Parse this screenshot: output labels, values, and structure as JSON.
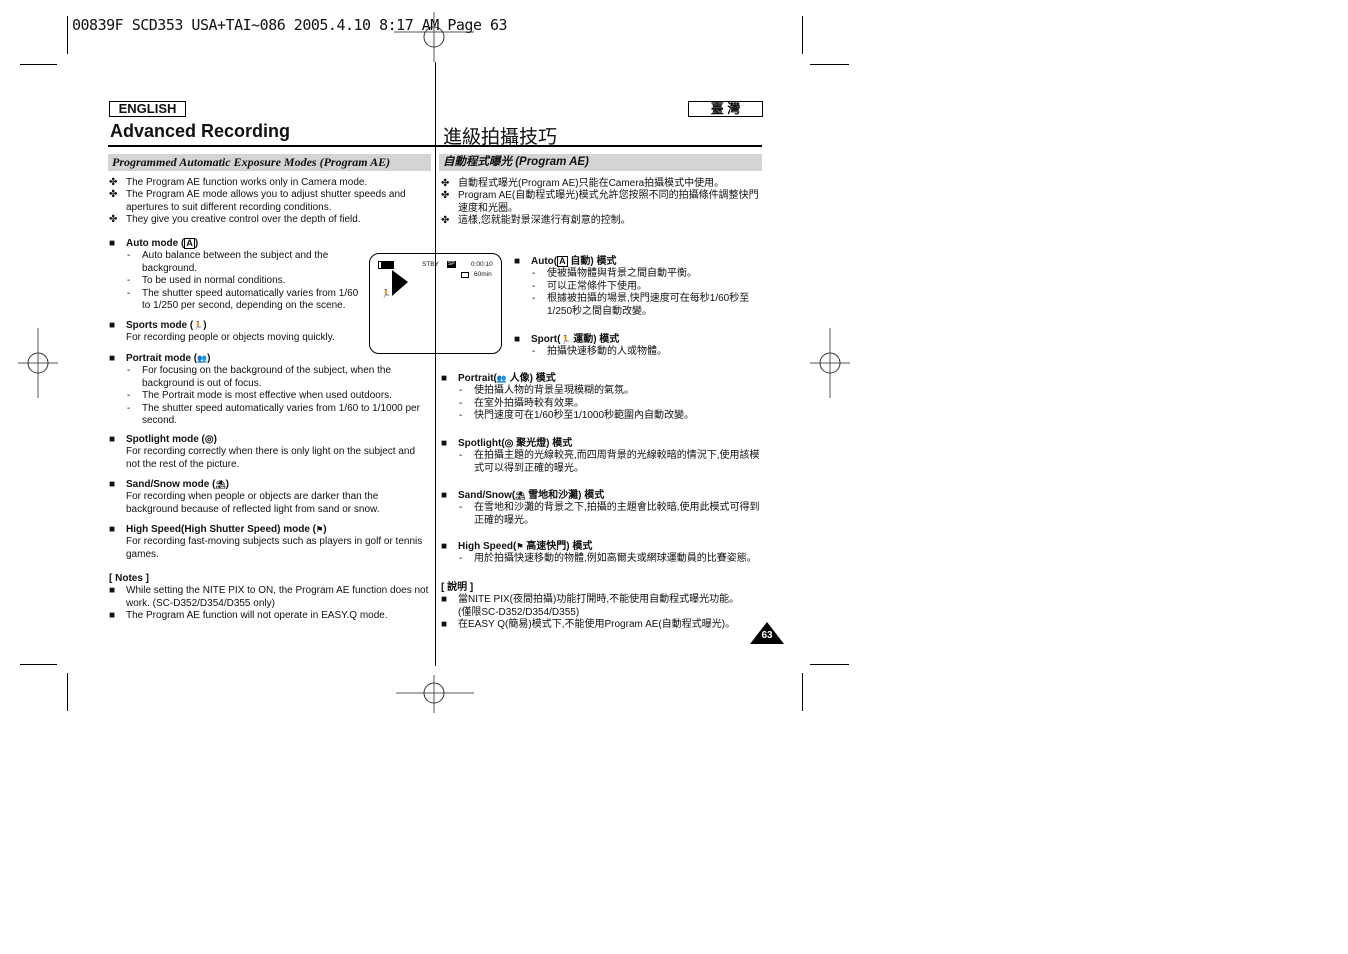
{
  "print_slug": "00839F SCD353 USA+TAI~086  2005.4.10  8:17 AM  Page 63",
  "english": {
    "lang_label": "ENGLISH",
    "title": "Advanced Recording",
    "section_title": "Programmed  Automatic Exposure Modes (Program AE)",
    "intro_bullets": [
      "The Program AE function works only in Camera mode.",
      "The Program AE mode allows you to adjust shutter speeds and apertures to suit different recording conditions.",
      "They give you creative control over the depth of field."
    ],
    "modes": [
      {
        "heading": "Auto mode (",
        "icon": "A",
        "heading_end": ")",
        "lines": [
          "Auto balance between the subject and the background.",
          "To be used in normal conditions.",
          "The shutter speed automatically varies from 1/60 to 1/250 per second, depending on the scene."
        ]
      },
      {
        "heading": "Sports mode (",
        "icon": "🏃",
        "heading_end": ")",
        "text": "For recording people or objects moving quickly."
      },
      {
        "heading": "Portrait mode (",
        "icon": "👥",
        "heading_end": ")",
        "lines": [
          "For focusing on the background of the subject, when the background is out of focus.",
          "The Portrait mode is most effective when used outdoors.",
          "The shutter speed automatically varies from 1/60 to 1/1000 per second."
        ]
      },
      {
        "heading": "Spotlight mode (",
        "icon": "◎",
        "heading_end": ")",
        "text": "For recording correctly when there is only light on the subject and not the rest of the picture."
      },
      {
        "heading": "Sand/Snow mode (",
        "icon": "⛱",
        "heading_end": ")",
        "text": "For recording when people or objects are darker than the background because of reflected light from sand or snow."
      },
      {
        "heading": "High Speed(High Shutter Speed) mode (",
        "icon": "⚑",
        "heading_end": ")",
        "text": "For recording fast-moving subjects such as players in golf or tennis games."
      }
    ],
    "notes_label": "[ Notes ]",
    "notes": [
      "While setting the NITE PIX to ON, the Program AE function does not work. (SC-D352/D354/D355 only)",
      "The Program AE function will not operate in EASY.Q mode."
    ]
  },
  "lcd": {
    "status": "STBY",
    "sp_label": "SP",
    "timecode": "0:00:10",
    "remaining": "60min"
  },
  "chinese": {
    "lang_label": "臺 灣",
    "title": "進級拍攝技巧",
    "section_title": "自動程式曝光 (Program AE)",
    "intro_bullets": [
      "自動程式曝光(Program AE)只能在Camera拍攝模式中使用。",
      "Program AE(自動程式曝光)模式允許您按照不同的拍攝條件調整快門速度和光圈。",
      "這樣,您就能對景深進行有創意的控制。"
    ],
    "modes": [
      {
        "heading": "Auto(",
        "icon": "A",
        "heading_end": " 自動) 模式",
        "lines": [
          "使被攝物體與背景之間自動平衡。",
          "可以正常條件下使用。",
          "根據被拍攝的場景,快門速度可在每秒1/60秒至1/250秒之間自動改變。"
        ]
      },
      {
        "heading": "Sport(",
        "icon": "🏃",
        "heading_end": " 運動) 模式",
        "lines": [
          "拍攝快速移動的人或物體。"
        ]
      },
      {
        "heading": "Portrait(",
        "icon": "👥",
        "heading_end": " 人像) 模式",
        "lines": [
          "使拍攝人物的背景呈現模糊的氣氛。",
          "在室外拍攝時較有效果。",
          "快門速度可在1/60秒至1/1000秒範圍內自動改變。"
        ]
      },
      {
        "heading": "Spotlight(",
        "icon": "◎",
        "heading_end": " 聚光燈) 模式",
        "lines": [
          "在拍攝主題的光線較亮,而四周背景的光線較暗的情況下,使用該模式可以得到正確的曝光。"
        ]
      },
      {
        "heading": "Sand/Snow(",
        "icon": "⛱",
        "heading_end": " 雪地和沙灘) 模式",
        "lines": [
          "在雪地和沙灘的背景之下,拍攝的主題會比較暗,使用此模式可得到正確的曝光。"
        ]
      },
      {
        "heading": "High Speed(",
        "icon": "⚑",
        "heading_end": " 高速快門) 模式",
        "lines": [
          "用於拍攝快速移動的物體,例如高爾夫或網球運動員的比賽姿態。"
        ]
      }
    ],
    "notes_label": "[ 說明 ]",
    "notes": [
      "當NITE PIX(夜間拍攝)功能打開時,不能使用自動程式曝光功能。(僅限SC-D352/D354/D355)",
      "在EASY Q(簡易)模式下,不能使用Program AE(自動程式曝光)。"
    ]
  },
  "page_number": "63"
}
